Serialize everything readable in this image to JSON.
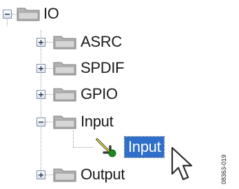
{
  "tree": {
    "root": {
      "label": "IO",
      "state": "expanded"
    },
    "children": [
      {
        "label": "ASRC",
        "state": "collapsed"
      },
      {
        "label": "SPDIF",
        "state": "collapsed"
      },
      {
        "label": "GPIO",
        "state": "collapsed"
      },
      {
        "label": "Input",
        "state": "expanded",
        "children": [
          {
            "label": "Input",
            "selected": true
          }
        ]
      },
      {
        "label": "Output",
        "state": "collapsed"
      }
    ]
  },
  "figure_id": "08363-019",
  "colors": {
    "selection": "#2f6fc9",
    "folder": "#a9a9a9",
    "connector": "#9a9a9a",
    "node_arrow": "#1a8a1a"
  }
}
